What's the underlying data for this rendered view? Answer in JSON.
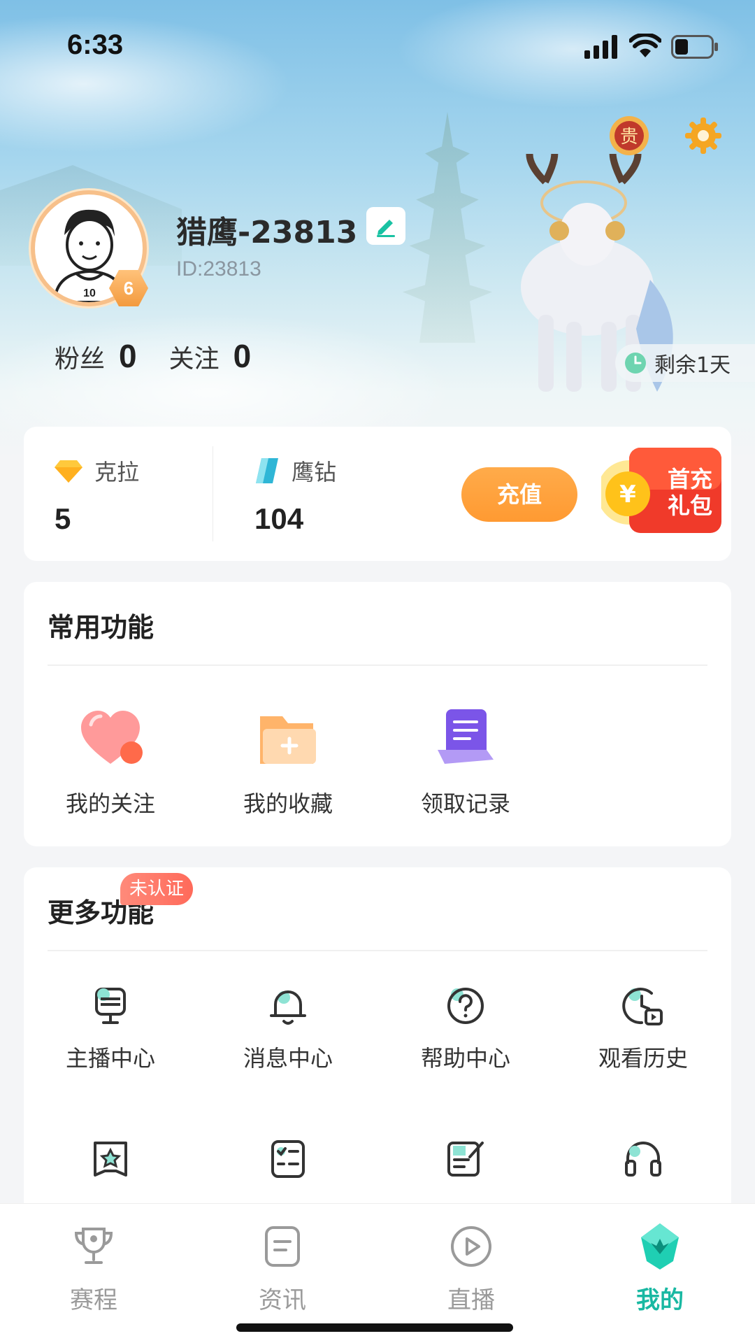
{
  "status_bar": {
    "time": "6:33"
  },
  "profile": {
    "nickname": "猎鹰-23813",
    "id_text": "ID:23813",
    "level": "6",
    "fans_label": "粉丝",
    "fans_count": "0",
    "following_label": "关注",
    "following_count": "0",
    "remaining_text": "剩余1天"
  },
  "wallet": {
    "carat_label": "克拉",
    "carat_value": "5",
    "diamond_label": "鹰钻",
    "diamond_value": "104",
    "recharge_label": "充值",
    "gift_label": "首充礼包"
  },
  "common_functions": {
    "title": "常用功能",
    "items": [
      {
        "label": "我的关注",
        "icon": "heart-icon"
      },
      {
        "label": "我的收藏",
        "icon": "folder-icon"
      },
      {
        "label": "领取记录",
        "icon": "record-icon"
      }
    ]
  },
  "more_functions": {
    "title": "更多功能",
    "badge": "未认证",
    "items": [
      {
        "label": "主播中心",
        "icon": "microphone-icon"
      },
      {
        "label": "消息中心",
        "icon": "bell-icon"
      },
      {
        "label": "帮助中心",
        "icon": "question-icon"
      },
      {
        "label": "观看历史",
        "icon": "history-icon"
      }
    ],
    "row2_icons": [
      "star-card-icon",
      "checklist-icon",
      "edit-note-icon",
      "headset-icon"
    ]
  },
  "tabbar": {
    "tabs": [
      {
        "label": "赛程",
        "icon": "trophy-icon"
      },
      {
        "label": "资讯",
        "icon": "news-icon"
      },
      {
        "label": "直播",
        "icon": "play-icon"
      },
      {
        "label": "我的",
        "icon": "profile-gem-icon"
      }
    ],
    "active_color": "#19b8a2"
  },
  "colors": {
    "accent": "#19b8a2",
    "recharge": "#ff9a32",
    "badge": "#ff6a5a"
  }
}
